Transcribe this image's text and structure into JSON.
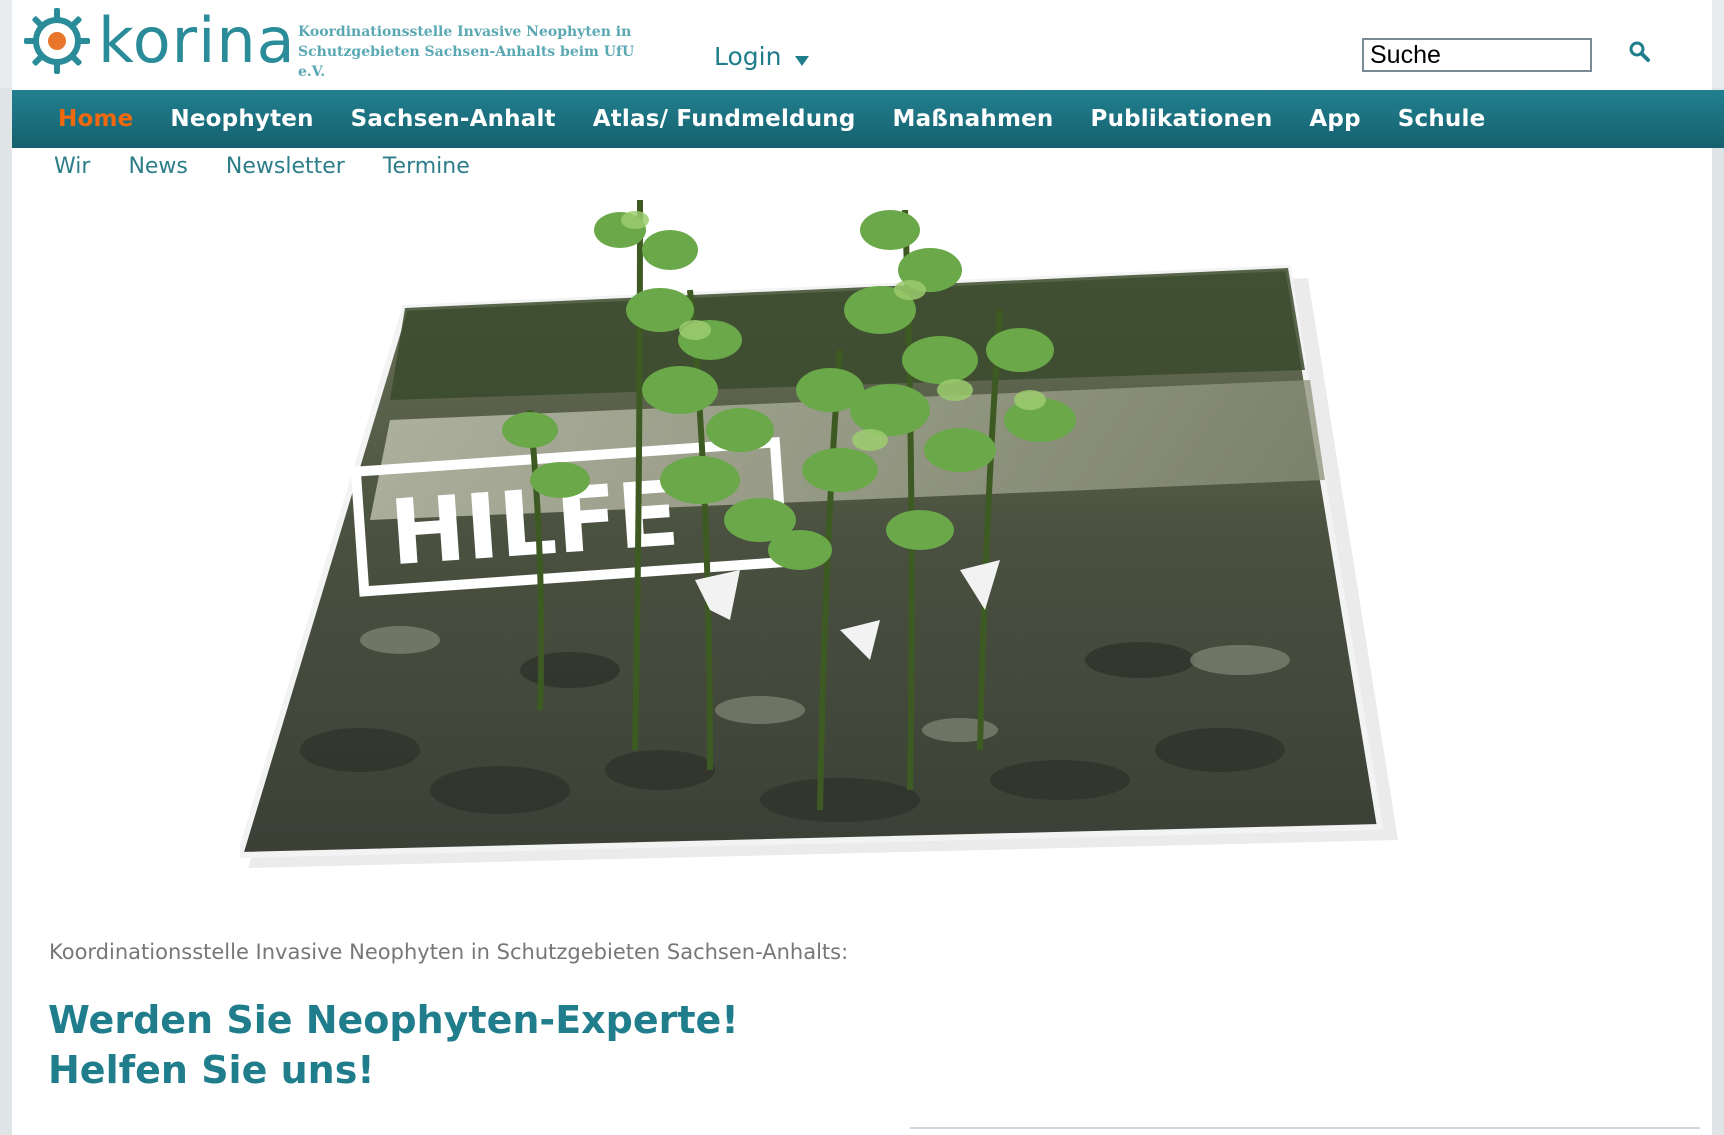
{
  "header": {
    "logo_text": "korina",
    "tagline_line1": "Koordinationsstelle Invasive Neophyten in",
    "tagline_line2": "Schutzgebieten Sachsen-Anhalts beim UfU e.V.",
    "login_label": "Login",
    "search_value": "Suche",
    "icons": [
      "gear-logo-icon",
      "caret-down-icon",
      "search-icon"
    ]
  },
  "nav": {
    "items": [
      {
        "label": "Home",
        "active": true
      },
      {
        "label": "Neophyten"
      },
      {
        "label": "Sachsen-Anhalt"
      },
      {
        "label": "Atlas/ Fundmeldung"
      },
      {
        "label": "Maßnahmen"
      },
      {
        "label": "Publikationen"
      },
      {
        "label": "App"
      },
      {
        "label": "Schule"
      }
    ]
  },
  "subnav": {
    "items": [
      "Wir",
      "News",
      "Newsletter",
      "Termine"
    ]
  },
  "hero": {
    "sign_text": "HILFE"
  },
  "content": {
    "intro": "Koordinationsstelle Invasive Neophyten in Schutzgebieten Sachsen-Anhalts:",
    "headline_line1": "Werden Sie Neophyten-Experte!",
    "headline_line2": "Helfen Sie uns!"
  },
  "colors": {
    "brand_teal": "#1f7d8c",
    "nav_bg": "#1a7080",
    "active_orange": "#f0690f",
    "logo_orange": "#e8762b"
  }
}
